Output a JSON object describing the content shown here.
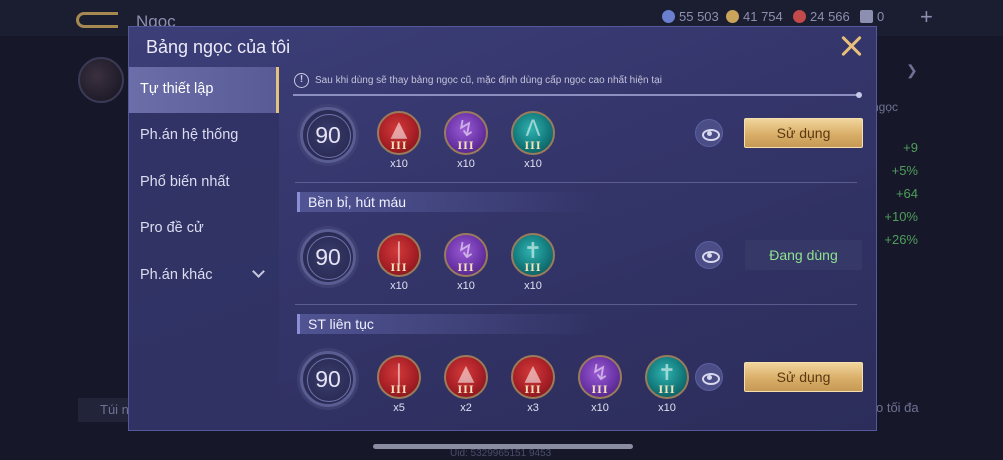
{
  "background": {
    "title": "Ngọc",
    "resources": [
      {
        "value": "55 503",
        "color": "#6a7fd0"
      },
      {
        "value": "41 754",
        "color": "#c9a45a"
      },
      {
        "value": "24 566",
        "color": "#c24a4a"
      },
      {
        "value": "0",
        "color": "#8c8fb0"
      }
    ],
    "stats": [
      "+9",
      "+5%",
      "+64",
      "+10%",
      "+26%"
    ],
    "side_label": "ngọc",
    "bottom_left": "Túi n",
    "bottom_right": "o tối đa",
    "uid": "Uid: 5329965151 9453"
  },
  "dialog": {
    "title": "Bảng ngọc của tôi",
    "notice": "Sau khi dùng sẽ thay bảng ngọc cũ, mặc định dùng cấp ngọc cao nhất hiện tại",
    "sidebar": [
      {
        "label": "Tự thiết lập",
        "active": true
      },
      {
        "label": "Ph.án hệ thống",
        "active": false
      },
      {
        "label": "Phổ biến nhất",
        "active": false
      },
      {
        "label": "Pro đề cử",
        "active": false
      },
      {
        "label": "Ph.án khác",
        "active": false
      }
    ],
    "pages": [
      {
        "name": "",
        "level": "90",
        "gems": [
          {
            "color": "red",
            "tier": "III",
            "count": "x10"
          },
          {
            "color": "purple",
            "tier": "III",
            "count": "x10"
          },
          {
            "color": "teal",
            "tier": "III",
            "count": "x10"
          }
        ],
        "action": "Sử dụng"
      },
      {
        "name": "Bền bỉ, hút máu",
        "level": "90",
        "gems": [
          {
            "color": "red",
            "tier": "III",
            "count": "x10"
          },
          {
            "color": "purple",
            "tier": "III",
            "count": "x10"
          },
          {
            "color": "teal",
            "tier": "III",
            "count": "x10"
          }
        ],
        "action": "Đang dùng"
      },
      {
        "name": "ST liên tục",
        "level": "90",
        "gems": [
          {
            "color": "red",
            "tier": "III",
            "count": "x5"
          },
          {
            "color": "red",
            "tier": "III",
            "count": "x2"
          },
          {
            "color": "red",
            "tier": "III",
            "count": "x3"
          },
          {
            "color": "purple",
            "tier": "III",
            "count": "x10"
          },
          {
            "color": "teal",
            "tier": "III",
            "count": "x10"
          }
        ],
        "action": "Sử dụng"
      }
    ]
  }
}
